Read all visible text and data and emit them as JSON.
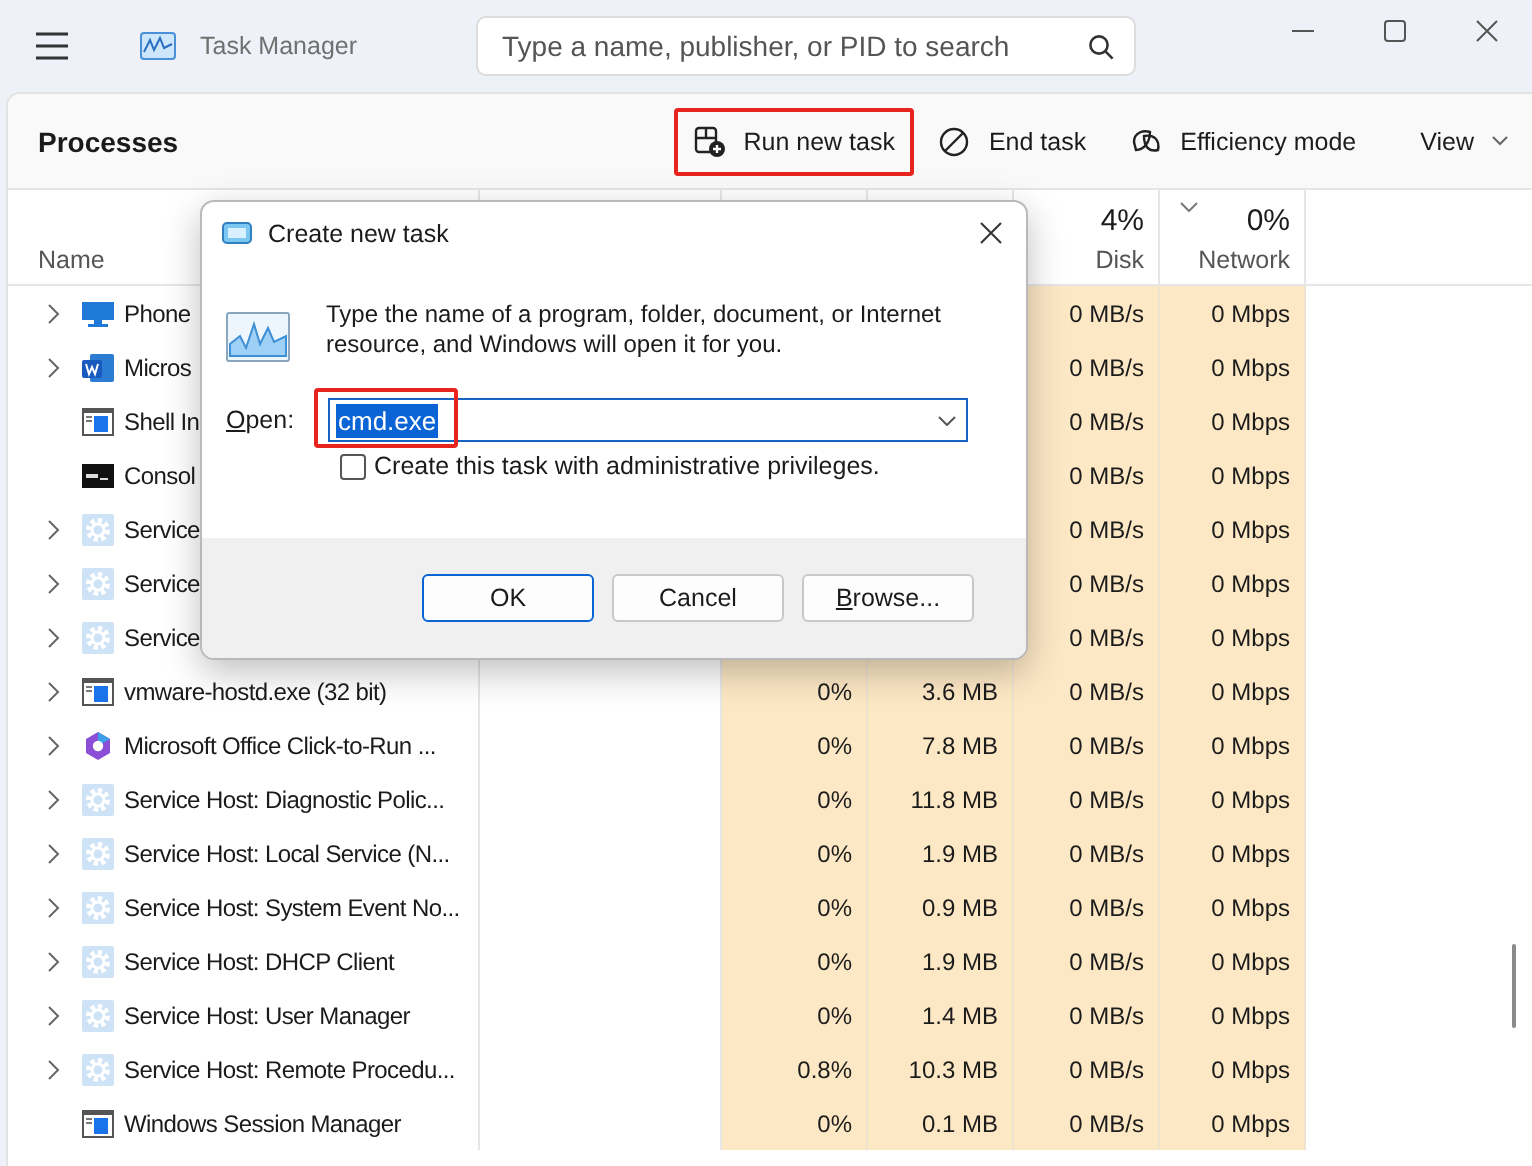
{
  "window": {
    "title": "Task Manager",
    "search": {
      "placeholder": "Type a name, publisher, or PID to search"
    }
  },
  "toolbar": {
    "title": "Processes",
    "buttons": [
      {
        "kind": "run",
        "label": "Run new task",
        "highlighted": true
      },
      {
        "kind": "end",
        "label": "End task",
        "highlighted": false
      },
      {
        "kind": "leaf",
        "label": "Efficiency mode",
        "highlighted": false
      },
      {
        "kind": "view",
        "label": "View",
        "highlighted": false
      }
    ]
  },
  "table": {
    "columns": [
      {
        "label": "Name"
      },
      {
        "percent": "4%",
        "label": "Disk"
      },
      {
        "percent": "0%",
        "label": "Network",
        "sorted": true
      }
    ],
    "rows": [
      {
        "kind": "monitor",
        "name": "Phone",
        "expandable": true,
        "disk": "0 MB/s",
        "network": "0 Mbps"
      },
      {
        "kind": "word",
        "name": "Micros",
        "expandable": true,
        "disk": "0 MB/s",
        "network": "0 Mbps"
      },
      {
        "kind": "window",
        "name": "Shell In",
        "expandable": false,
        "disk": "0 MB/s",
        "network": "0 Mbps"
      },
      {
        "kind": "console",
        "name": "Consol",
        "expandable": false,
        "disk": "0 MB/s",
        "network": "0 Mbps"
      },
      {
        "kind": "gear",
        "name": "Service",
        "expandable": true,
        "disk": "0 MB/s",
        "network": "0 Mbps"
      },
      {
        "kind": "gear",
        "name": "Service",
        "expandable": true,
        "disk": "0 MB/s",
        "network": "0 Mbps"
      },
      {
        "kind": "gear",
        "name": "Service",
        "expandable": true,
        "disk": "0 MB/s",
        "network": "0 Mbps"
      },
      {
        "kind": "window",
        "name": "vmware-hostd.exe (32 bit)",
        "expandable": true,
        "cpu": "0%",
        "memory": "3.6 MB",
        "disk": "0 MB/s",
        "network": "0 Mbps"
      },
      {
        "kind": "office",
        "name": "Microsoft Office Click-to-Run ...",
        "expandable": true,
        "cpu": "0%",
        "memory": "7.8 MB",
        "disk": "0 MB/s",
        "network": "0 Mbps"
      },
      {
        "kind": "gear",
        "name": "Service Host: Diagnostic Polic...",
        "expandable": true,
        "cpu": "0%",
        "memory": "11.8 MB",
        "disk": "0 MB/s",
        "network": "0 Mbps"
      },
      {
        "kind": "gear",
        "name": "Service Host: Local Service (N...",
        "expandable": true,
        "cpu": "0%",
        "memory": "1.9 MB",
        "disk": "0 MB/s",
        "network": "0 Mbps"
      },
      {
        "kind": "gear",
        "name": "Service Host: System Event No...",
        "expandable": true,
        "cpu": "0%",
        "memory": "0.9 MB",
        "disk": "0 MB/s",
        "network": "0 Mbps"
      },
      {
        "kind": "gear",
        "name": "Service Host: DHCP Client",
        "expandable": true,
        "cpu": "0%",
        "memory": "1.9 MB",
        "disk": "0 MB/s",
        "network": "0 Mbps"
      },
      {
        "kind": "gear",
        "name": "Service Host: User Manager",
        "expandable": true,
        "cpu": "0%",
        "memory": "1.4 MB",
        "disk": "0 MB/s",
        "network": "0 Mbps"
      },
      {
        "kind": "gear",
        "name": "Service Host: Remote Procedu...",
        "expandable": true,
        "cpu": "0.8%",
        "memory": "10.3 MB",
        "disk": "0 MB/s",
        "network": "0 Mbps"
      },
      {
        "kind": "window",
        "name": "Windows Session Manager",
        "expandable": false,
        "cpu": "0%",
        "memory": "0.1 MB",
        "disk": "0 MB/s",
        "network": "0 Mbps"
      }
    ]
  },
  "dialog": {
    "title": "Create new task",
    "message": "Type the name of a program, folder, document, or Internet resource, and Windows will open it for you.",
    "open_label": "Open:",
    "open_value": "cmd.exe",
    "value_highlighted": true,
    "admin_checkbox": {
      "label": "Create this task with administrative privileges.",
      "checked": false
    },
    "buttons": [
      {
        "label": "OK",
        "default": true
      },
      {
        "label": "Cancel",
        "default": false
      },
      {
        "label": "Browse...",
        "default": false
      }
    ]
  }
}
